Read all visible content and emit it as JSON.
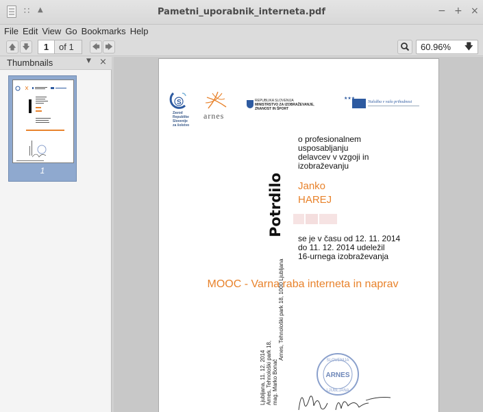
{
  "window": {
    "title": "Pametni_uporabnik_interneta.pdf",
    "controls": [
      "−",
      "+",
      "×"
    ]
  },
  "menu": [
    "File",
    "Edit",
    "View",
    "Go",
    "Bookmarks",
    "Help"
  ],
  "toolbar": {
    "page_current": "1",
    "page_of": "of 1",
    "zoom": "60.96%"
  },
  "sidebar": {
    "title": "Thumbnails",
    "thumb_label": "1"
  },
  "document": {
    "logos": {
      "zavod": [
        "Zavod",
        "Republike",
        "Slovenije",
        "za šolstvo"
      ],
      "arnes": "arnes",
      "ministry": [
        "REPUBLIKA SLOVENIJA",
        "MINISTRSTVO ZA IZOBRAŽEVANJE,",
        "ZNANOST IN ŠPORT"
      ],
      "eu": "Naložba v vašo prihodnost"
    },
    "intro": [
      "o profesionalnem",
      "usposabljanju",
      "delavcev v vzgoji in",
      "izobraževanju"
    ],
    "heading": "Potrdilo",
    "first_name": "Janko",
    "last_name": "HAREJ",
    "body": [
      "se je v času od 12. 11. 2014",
      "do 11. 12. 2014 udeležil",
      "16-urnega izobraževanja"
    ],
    "course": "MOOC - Varna raba interneta in naprav",
    "address": "Arnes, Tehnološki park 18, 1000 Ljubljana",
    "sign_lines": [
      "Ljubljana, 11. 12. 2014",
      "Arnes, Tehnološki park 18,",
      "mag. Marko Bonač"
    ],
    "stamp": "ARNES",
    "stamp_ring": [
      "SLOVENIJA",
      "LJUBLJANA"
    ]
  },
  "colors": {
    "accent": "#e8822b",
    "thumb_selection": "#8fa9cf",
    "logo_blue": "#2d5aa0"
  }
}
